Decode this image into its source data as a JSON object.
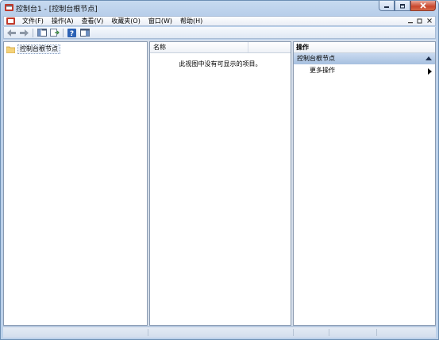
{
  "window": {
    "title": "控制台1 - [控制台根节点]"
  },
  "menu": {
    "items": [
      "文件(F)",
      "操作(A)",
      "查看(V)",
      "收藏夹(O)",
      "窗口(W)",
      "帮助(H)"
    ]
  },
  "tree": {
    "root_label": "控制台根节点"
  },
  "list": {
    "column_name": "名称",
    "empty_message": "此视图中没有可显示的项目。"
  },
  "actions": {
    "title": "操作",
    "section_label": "控制台根节点",
    "items": [
      {
        "label": "更多操作"
      }
    ]
  },
  "colors": {
    "accent": "#a6bfdf",
    "close": "#c9462c"
  },
  "icons": [
    "app-icon",
    "back-icon",
    "forward-icon",
    "console-tree-icon",
    "export-list-icon",
    "help-icon",
    "action-pane-icon",
    "folder-icon"
  ]
}
